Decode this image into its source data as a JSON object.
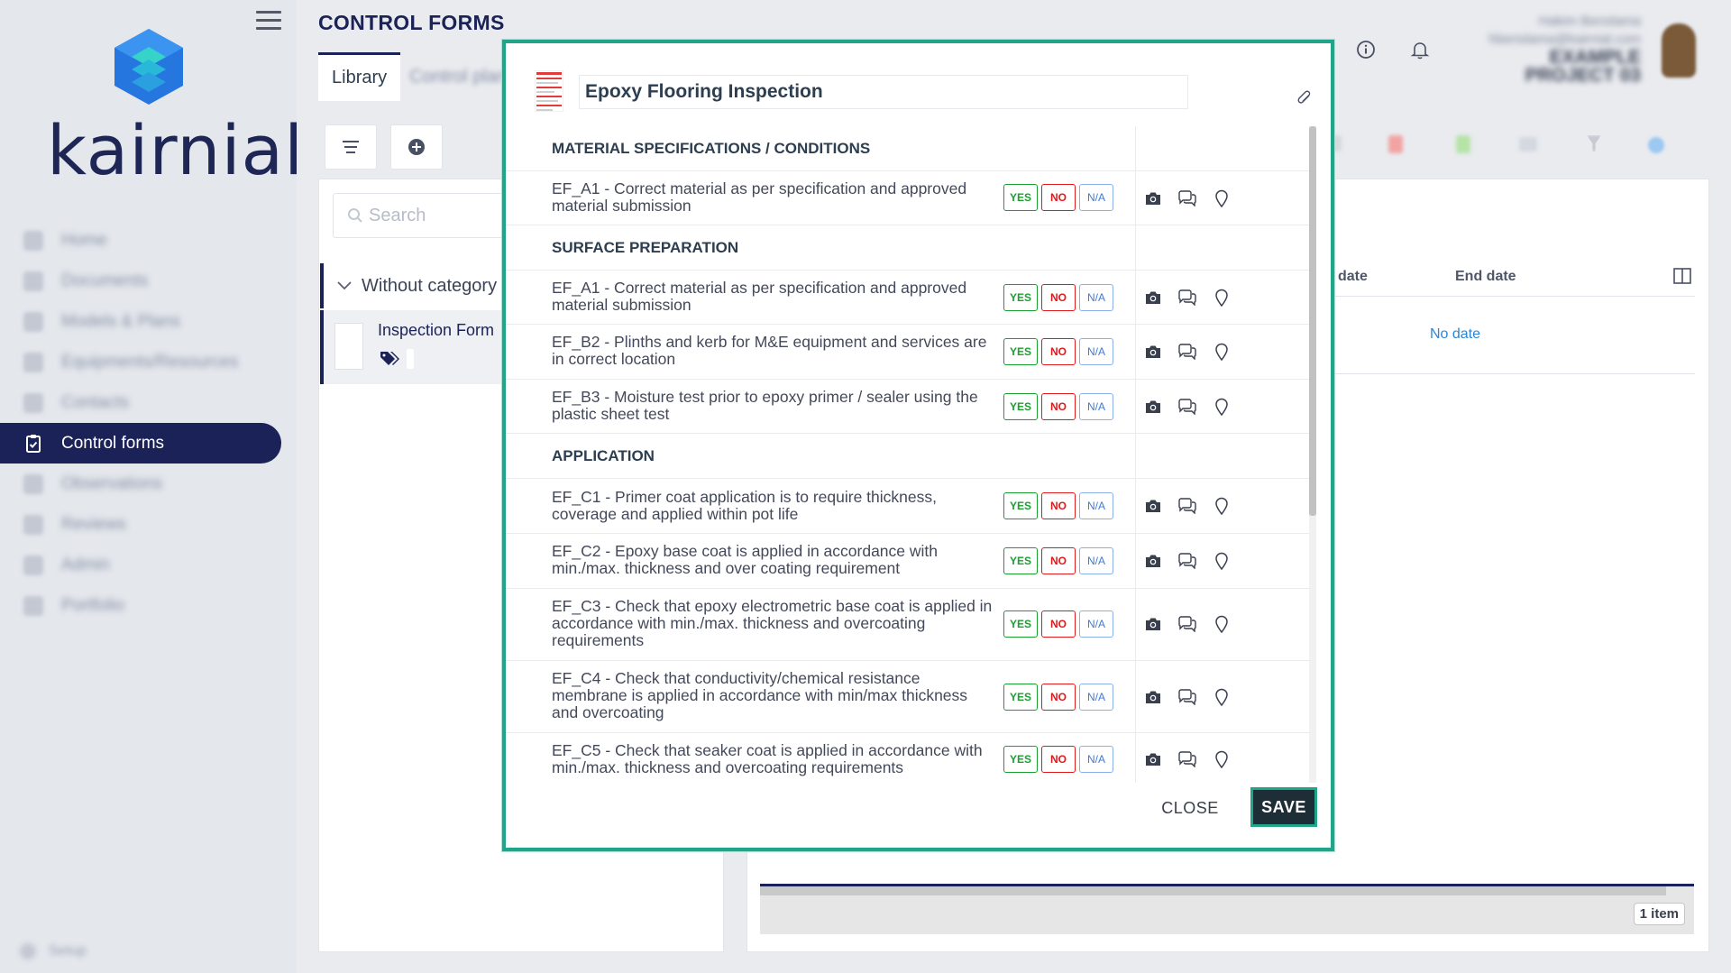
{
  "app": {
    "name": "kairnial",
    "page_title": "CONTROL FORMS"
  },
  "sidebar": {
    "items": [
      {
        "label": "Home",
        "icon": "home-icon"
      },
      {
        "label": "Documents",
        "icon": "documents-icon"
      },
      {
        "label": "Models & Plans",
        "icon": "models-icon"
      },
      {
        "label": "Equipments/Resources",
        "icon": "equipment-icon"
      },
      {
        "label": "Contacts",
        "icon": "contacts-icon"
      },
      {
        "label": "Control forms",
        "icon": "clipboard-check-icon",
        "active": true
      },
      {
        "label": "Observations",
        "icon": "observations-icon"
      },
      {
        "label": "Reviews",
        "icon": "reviews-icon"
      },
      {
        "label": "Admin",
        "icon": "admin-icon"
      },
      {
        "label": "Portfolio",
        "icon": "portfolio-icon"
      }
    ],
    "settings_label": "Setup"
  },
  "tabs": [
    {
      "label": "Library",
      "active": true
    },
    {
      "label": "Control plans",
      "active": false
    }
  ],
  "header": {
    "user_name": "Hakim Benslama",
    "user_email": "hbenslama@kairnial.com",
    "project_line1": "EXAMPLE",
    "project_line2": "PROJECT 03"
  },
  "library": {
    "search_placeholder": "Search",
    "category": "Without category",
    "form_name": "Inspection Form"
  },
  "list": {
    "col_start": "date",
    "col_end": "End date",
    "no_date": "No date",
    "item_count": "1 item"
  },
  "modal": {
    "title": "Epoxy Flooring Inspection",
    "close_label": "CLOSE",
    "save_label": "SAVE",
    "yes_label": "YES",
    "no_label": "NO",
    "na_label": "N/A",
    "sections": [
      {
        "title": "MATERIAL SPECIFICATIONS / CONDITIONS"
      },
      {
        "title": "SURFACE PREPARATION"
      },
      {
        "title": "APPLICATION"
      }
    ],
    "items": [
      {
        "line1": "EF_A1 - Correct material as per specification and approved",
        "line2": "material submission",
        "line3": ""
      },
      {
        "line1": "EF_A1 - Correct material as per specification and approved",
        "line2": "material submission",
        "line3": ""
      },
      {
        "line1": "EF_B2 - Plinths and kerb for M&E equipment and services are",
        "line2": "in correct location",
        "line3": ""
      },
      {
        "line1": "EF_B3 - Moisture test prior to epoxy primer / sealer using the",
        "line2": "plastic sheet test",
        "line3": ""
      },
      {
        "line1": "EF_C1 - Primer coat application is to require thickness,",
        "line2": "coverage and applied within pot life",
        "line3": ""
      },
      {
        "line1": "EF_C2 - Epoxy base coat is applied in accordance with",
        "line2": "min./max. thickness and over coating requirement",
        "line3": ""
      },
      {
        "line1": "EF_C3 - Check that epoxy electrometric base coat is applied in",
        "line2": "accordance with min./max. thickness and overcoating",
        "line3": "requirements"
      },
      {
        "line1": "EF_C4 - Check that conductivity/chemical resistance",
        "line2": "membrane is applied in accordance with min/max thickness",
        "line3": "and overcoating"
      },
      {
        "line1": "EF_C5 - Check that seaker coat is applied in accordance with",
        "line2": "min./max. thickness and overcoating requirements",
        "line3": ""
      }
    ]
  },
  "colors": {
    "brand_navy": "#1b2257",
    "accent_teal": "#1ea58a",
    "yes_green": "#19a02f",
    "no_red": "#e01a1a",
    "na_blue": "#3d7bd8"
  }
}
